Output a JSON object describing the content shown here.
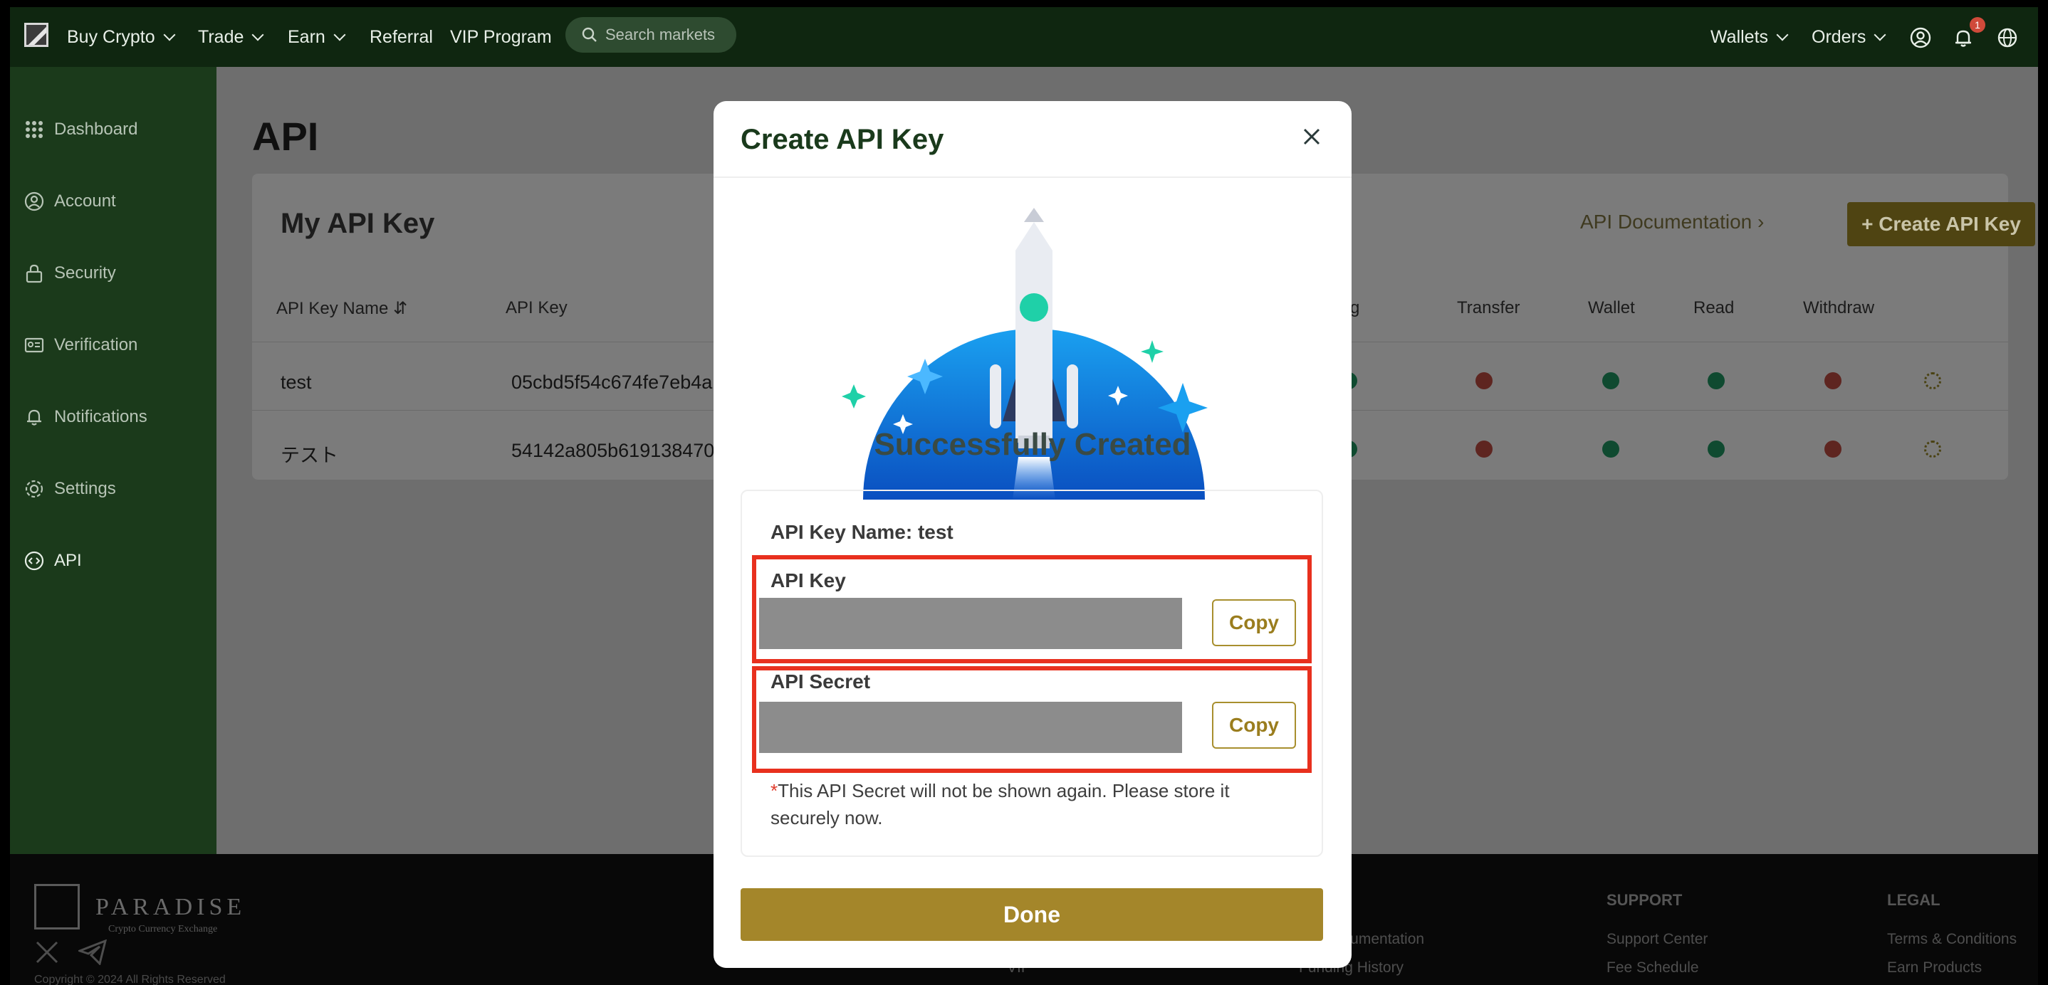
{
  "nav": {
    "items": [
      {
        "label": "Buy Crypto",
        "dropdown": true
      },
      {
        "label": "Trade",
        "dropdown": true
      },
      {
        "label": "Earn",
        "dropdown": true
      },
      {
        "label": "Referral",
        "dropdown": false
      },
      {
        "label": "VIP Program",
        "dropdown": false
      }
    ],
    "search_placeholder": "Search markets",
    "right": {
      "wallets": "Wallets",
      "orders": "Orders",
      "notification_count": "1"
    }
  },
  "sidebar": {
    "items": [
      {
        "label": "Dashboard",
        "icon": "grid-icon"
      },
      {
        "label": "Account",
        "icon": "user-icon"
      },
      {
        "label": "Security",
        "icon": "lock-icon"
      },
      {
        "label": "Verification",
        "icon": "id-card-icon"
      },
      {
        "label": "Notifications",
        "icon": "bell-icon"
      },
      {
        "label": "Settings",
        "icon": "gear-icon"
      },
      {
        "label": "API",
        "icon": "code-icon"
      }
    ],
    "active": "API"
  },
  "main": {
    "title": "API",
    "card_title": "My API Key",
    "doc_link": "API Documentation",
    "create_button": "+ Create API Key",
    "columns": {
      "name": "API Key Name",
      "key": "API Key",
      "trading": "ding",
      "transfer": "Transfer",
      "wallet": "Wallet",
      "read": "Read",
      "withdraw": "Withdraw"
    },
    "rows": [
      {
        "name": "test",
        "key": "05cbd5f54c674fe7eb4a",
        "trading": "ok",
        "transfer": "no",
        "wallet": "ok",
        "read": "ok",
        "withdraw": "no"
      },
      {
        "name": "テスト",
        "key": "54142a805b619138470",
        "trading": "ok",
        "transfer": "no",
        "wallet": "ok",
        "read": "ok",
        "withdraw": "no"
      }
    ]
  },
  "footer": {
    "brand": "PARADISE",
    "brand_sub": "Crypto Currency Exchange",
    "copyright": "Copyright © 2024 All Rights Reserved",
    "col_vip": "VIP",
    "col_docs": [
      "ocumentation",
      "Funding History"
    ],
    "support_head": "SUPPORT",
    "support_links": [
      "Support Center",
      "Fee Schedule"
    ],
    "legal_head": "LEGAL",
    "legal_links": [
      "Terms & Conditions",
      "Earn Products"
    ]
  },
  "modal": {
    "title": "Create API Key",
    "success": "Successfully Created",
    "key_name_label": "API Key Name: test",
    "api_key_label": "API Key",
    "api_secret_label": "API Secret",
    "copy_label": "Copy",
    "note_asterisk": "*",
    "note": "This API Secret will not be shown again. Please store it securely now.",
    "done_label": "Done"
  },
  "colors": {
    "accent": "#a4862a",
    "highlight": "#e8301e",
    "nav_bg": "#0f2610"
  }
}
